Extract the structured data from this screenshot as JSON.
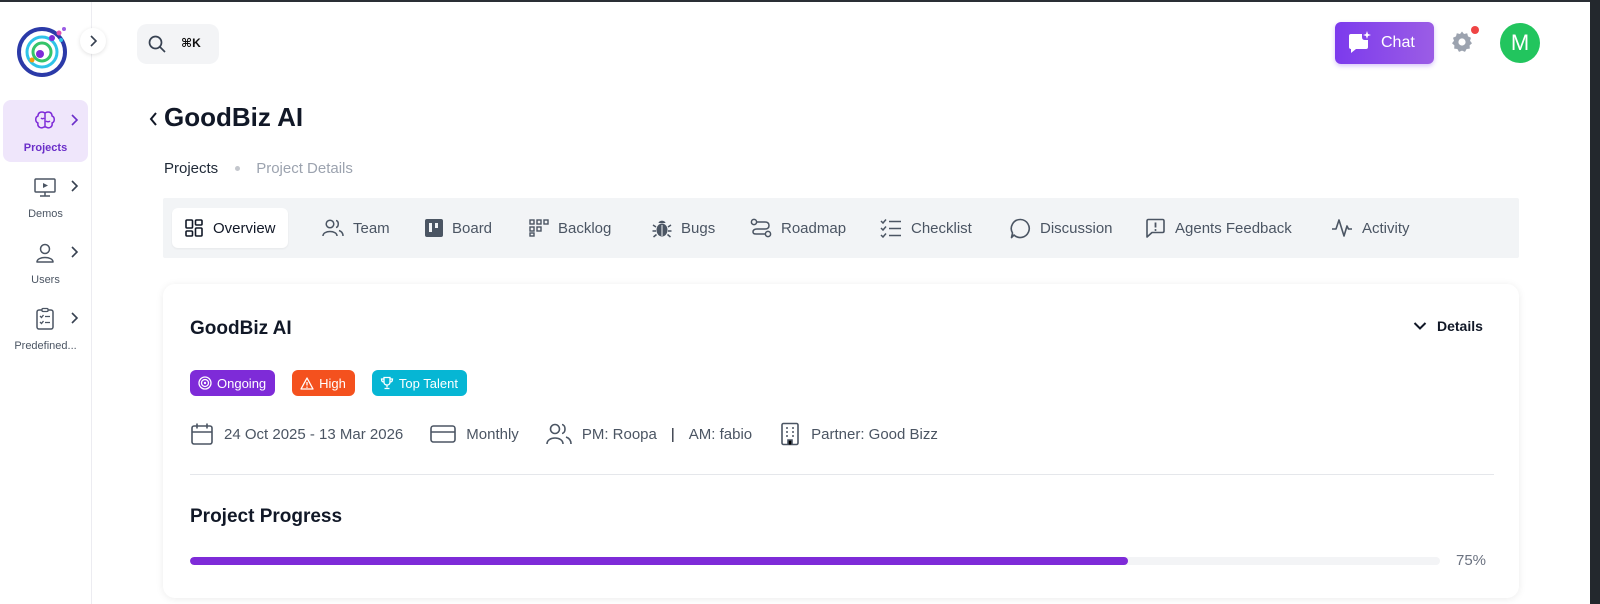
{
  "sidebar": {
    "items": [
      {
        "label": "Projects",
        "icon": "brain-icon",
        "active": true
      },
      {
        "label": "Demos",
        "icon": "presentation-icon",
        "active": false
      },
      {
        "label": "Users",
        "icon": "user-icon",
        "active": false
      },
      {
        "label": "Predefined...",
        "icon": "clipboard-checklist-icon",
        "active": false
      }
    ]
  },
  "topbar": {
    "search_shortcut": "⌘K",
    "chat_label": "Chat",
    "avatar_initial": "M"
  },
  "header": {
    "title": "GoodBiz AI",
    "breadcrumb": [
      "Projects",
      "Project Details"
    ]
  },
  "tabs": [
    {
      "label": "Overview",
      "icon": "grid-icon",
      "active": true
    },
    {
      "label": "Team",
      "icon": "team-icon"
    },
    {
      "label": "Board",
      "icon": "kanban-icon"
    },
    {
      "label": "Backlog",
      "icon": "backlog-icon"
    },
    {
      "label": "Bugs",
      "icon": "bug-icon"
    },
    {
      "label": "Roadmap",
      "icon": "route-icon"
    },
    {
      "label": "Checklist",
      "icon": "checklist-icon"
    },
    {
      "label": "Discussion",
      "icon": "chat-bubble-icon"
    },
    {
      "label": "Agents Feedback",
      "icon": "feedback-icon"
    },
    {
      "label": "Activity",
      "icon": "pulse-icon"
    }
  ],
  "project": {
    "name": "GoodBiz AI",
    "details_label": "Details",
    "badges": [
      {
        "label": "Ongoing",
        "icon": "target-icon",
        "color": "#7e2bd8"
      },
      {
        "label": "High",
        "icon": "warning-icon",
        "color": "#f4511e"
      },
      {
        "label": "Top Talent",
        "icon": "trophy-icon",
        "color": "#06b6d4"
      }
    ],
    "dates": "24 Oct 2025 - 13 Mar 2026",
    "billing": "Monthly",
    "pm": "PM: Roopa",
    "am": "AM: fabio",
    "partner": "Partner: Good Bizz",
    "progress_title": "Project Progress",
    "progress": 0.75,
    "progress_label": "75%"
  },
  "colors": {
    "accent": "#7e2bd8",
    "avatar": "#22c55e",
    "notification": "#ef4444"
  }
}
